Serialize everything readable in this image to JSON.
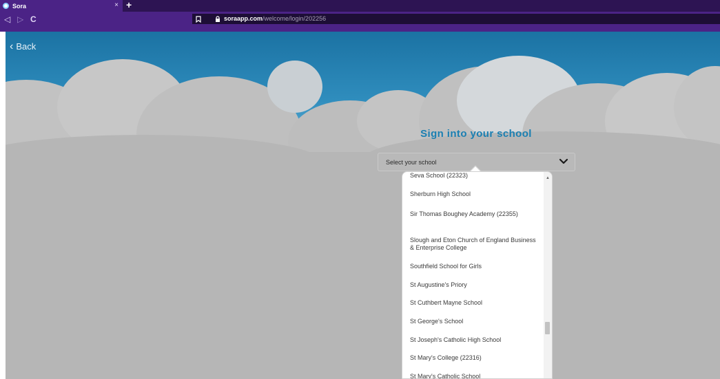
{
  "browser": {
    "tab_title": "Sora",
    "tab_close": "×",
    "new_tab": "+",
    "back": "◁",
    "forward": "▷",
    "reload": "C",
    "url_host": "soraapp.com",
    "url_path": "/welcome/login/202256"
  },
  "page": {
    "back_label": "Back",
    "heading": "Sign into your school",
    "select_placeholder": "Select your school",
    "schools": [
      "Seva School (22323)",
      "Sherburn High School",
      "Sir Thomas Boughey Academy (22355)",
      "Slough and Eton Church of England Business & Enterprise College",
      "Southfield School for Girls",
      "St Augustine's Priory",
      "St Cuthbert Mayne School",
      "St George's School",
      "St Joseph's Catholic High School",
      "St Mary's College (22316)",
      "St Mary's Catholic School"
    ]
  },
  "colors": {
    "browser_chrome": "#4b2386",
    "sky_blue": "#1b72a3",
    "heading": "#1a7fb2",
    "page_gray": "#b6b6b6"
  },
  "icons": [
    "back-icon",
    "forward-icon",
    "reload-icon",
    "bookmark-icon",
    "lock-icon",
    "chevron-down-icon",
    "chevron-left-icon"
  ]
}
